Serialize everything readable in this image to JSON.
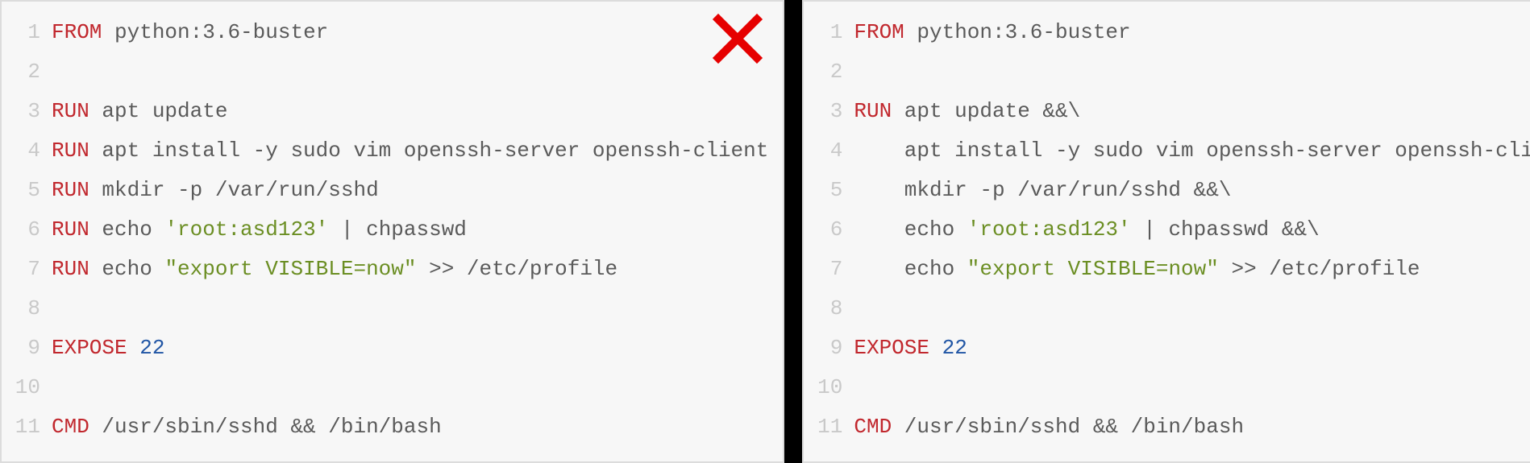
{
  "panels": {
    "left": {
      "mark": "cross",
      "lines": [
        {
          "no": 1,
          "tokens": [
            {
              "t": "FROM",
              "c": "kw"
            },
            {
              "t": " python:3.6-buster",
              "c": "txt"
            }
          ]
        },
        {
          "no": 2,
          "tokens": []
        },
        {
          "no": 3,
          "tokens": [
            {
              "t": "RUN",
              "c": "kw"
            },
            {
              "t": " apt update",
              "c": "txt"
            }
          ]
        },
        {
          "no": 4,
          "tokens": [
            {
              "t": "RUN",
              "c": "kw"
            },
            {
              "t": " apt install -y sudo vim openssh-server openssh-client",
              "c": "txt"
            }
          ]
        },
        {
          "no": 5,
          "tokens": [
            {
              "t": "RUN",
              "c": "kw"
            },
            {
              "t": " mkdir -p /var/run/sshd",
              "c": "txt"
            }
          ]
        },
        {
          "no": 6,
          "tokens": [
            {
              "t": "RUN",
              "c": "kw"
            },
            {
              "t": " echo ",
              "c": "txt"
            },
            {
              "t": "'root:asd123'",
              "c": "str1"
            },
            {
              "t": " | chpasswd",
              "c": "txt"
            }
          ]
        },
        {
          "no": 7,
          "tokens": [
            {
              "t": "RUN",
              "c": "kw"
            },
            {
              "t": " echo ",
              "c": "txt"
            },
            {
              "t": "\"export VISIBLE=now\"",
              "c": "str2"
            },
            {
              "t": " >> /etc/profile",
              "c": "txt"
            }
          ]
        },
        {
          "no": 8,
          "tokens": []
        },
        {
          "no": 9,
          "tokens": [
            {
              "t": "EXPOSE",
              "c": "kw"
            },
            {
              "t": " ",
              "c": "txt"
            },
            {
              "t": "22",
              "c": "num"
            }
          ]
        },
        {
          "no": 10,
          "tokens": []
        },
        {
          "no": 11,
          "tokens": [
            {
              "t": "CMD",
              "c": "kw"
            },
            {
              "t": " /usr/sbin/sshd && /bin/bash",
              "c": "txt"
            }
          ]
        }
      ]
    },
    "right": {
      "mark": "check",
      "lines": [
        {
          "no": 1,
          "tokens": [
            {
              "t": "FROM",
              "c": "kw"
            },
            {
              "t": " python:3.6-buster",
              "c": "txt"
            }
          ]
        },
        {
          "no": 2,
          "tokens": []
        },
        {
          "no": 3,
          "tokens": [
            {
              "t": "RUN",
              "c": "kw"
            },
            {
              "t": " apt update &&\\",
              "c": "txt"
            }
          ]
        },
        {
          "no": 4,
          "tokens": [
            {
              "t": "    apt install -y sudo vim openssh-server openssh-client &&\\",
              "c": "txt"
            }
          ]
        },
        {
          "no": 5,
          "tokens": [
            {
              "t": "    mkdir -p /var/run/sshd &&\\",
              "c": "txt"
            }
          ]
        },
        {
          "no": 6,
          "tokens": [
            {
              "t": "    echo ",
              "c": "txt"
            },
            {
              "t": "'root:asd123'",
              "c": "str1"
            },
            {
              "t": " | chpasswd &&\\",
              "c": "txt"
            }
          ]
        },
        {
          "no": 7,
          "tokens": [
            {
              "t": "    echo ",
              "c": "txt"
            },
            {
              "t": "\"export VISIBLE=now\"",
              "c": "str2"
            },
            {
              "t": " >> /etc/profile",
              "c": "txt"
            }
          ]
        },
        {
          "no": 8,
          "tokens": []
        },
        {
          "no": 9,
          "tokens": [
            {
              "t": "EXPOSE",
              "c": "kw"
            },
            {
              "t": " ",
              "c": "txt"
            },
            {
              "t": "22",
              "c": "num"
            }
          ]
        },
        {
          "no": 10,
          "tokens": []
        },
        {
          "no": 11,
          "tokens": [
            {
              "t": "CMD",
              "c": "kw"
            },
            {
              "t": " /usr/sbin/sshd && /bin/bash",
              "c": "txt"
            }
          ]
        }
      ]
    }
  },
  "colors": {
    "mark": "#e60000"
  }
}
